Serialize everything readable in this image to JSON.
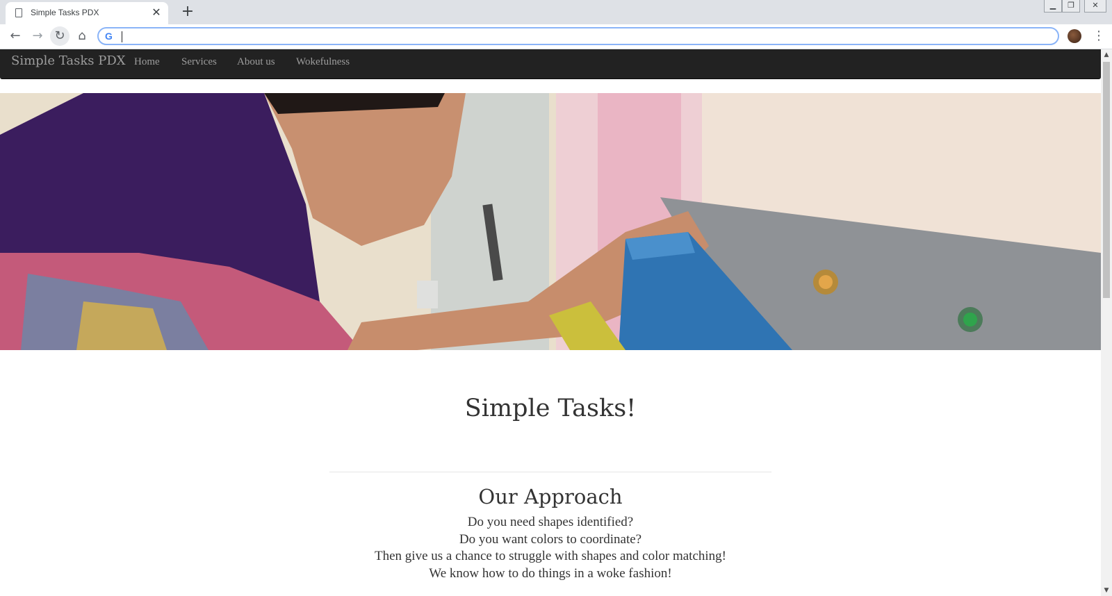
{
  "browser": {
    "tab_title": "Simple Tasks PDX",
    "tab_close": "✕",
    "new_tab": "+",
    "address_value": "",
    "search_engine_glyph": "G"
  },
  "site": {
    "brand": "Simple Tasks PDX",
    "nav": [
      "Home",
      "Services",
      "About us",
      "Wokefulness"
    ]
  },
  "main": {
    "heading": "Simple Tasks!",
    "section_title": "Our Approach",
    "lines": [
      "Do you need shapes identified?",
      "Do you want colors to coordinate?",
      "Then give us a chance to struggle with shapes and color matching!",
      "We know how to do things in a woke fashion!"
    ]
  },
  "colors": {
    "navbar_bg": "#222222",
    "nav_text": "#9d9d9d",
    "focus_ring": "#8ab4f8"
  }
}
